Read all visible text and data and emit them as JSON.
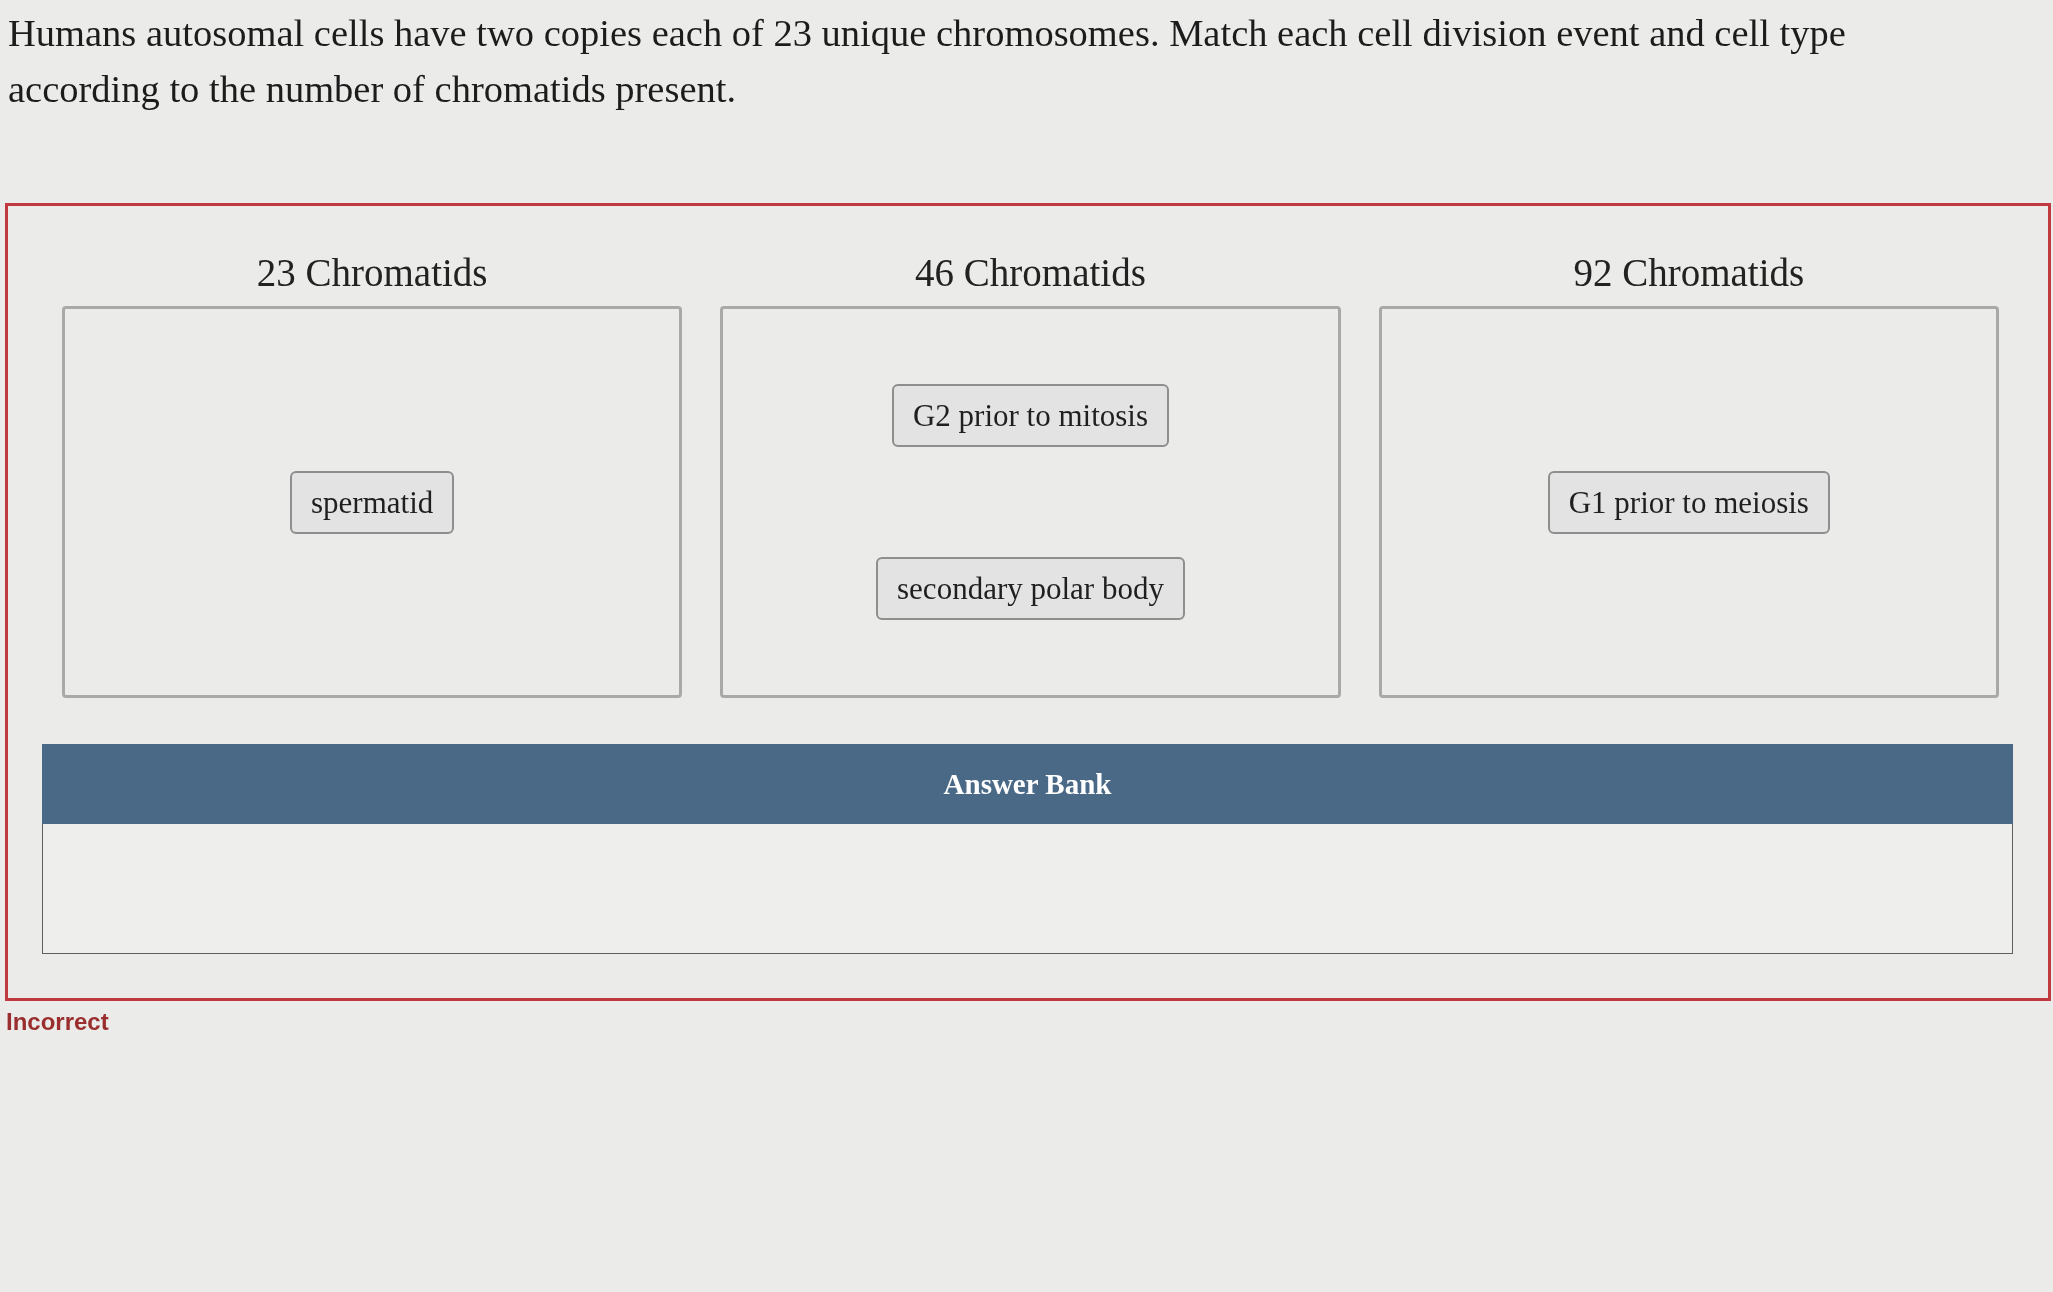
{
  "question": {
    "prompt": "Humans autosomal cells have two copies each of 23 unique chromosomes. Match each cell division event and cell type according to the number of chromatids present."
  },
  "targets": [
    {
      "heading": "23 Chromatids",
      "placed": [
        "spermatid"
      ]
    },
    {
      "heading": "46 Chromatids",
      "placed": [
        "G2 prior to mitosis",
        "secondary polar body"
      ]
    },
    {
      "heading": "92 Chromatids",
      "placed": [
        "G1 prior to meiosis"
      ]
    }
  ],
  "answer_bank": {
    "title": "Answer Bank"
  },
  "feedback": "Incorrect"
}
